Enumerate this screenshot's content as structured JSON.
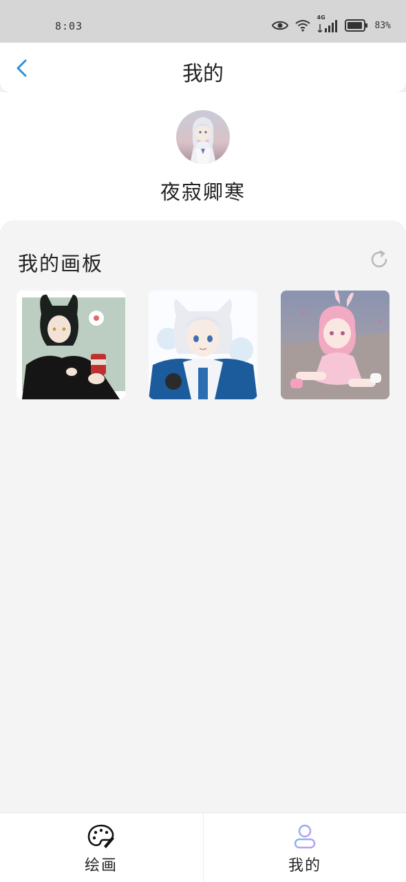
{
  "status_bar": {
    "time": "8:03",
    "network_label": "4G",
    "battery_text": "83%",
    "icons": [
      "eye-icon",
      "wifi-icon",
      "signal-icon",
      "battery-icon"
    ]
  },
  "header": {
    "title": "我的",
    "back_icon": "chevron-left-icon",
    "accent_color": "#2a8fd8"
  },
  "profile": {
    "username": "夜寂卿寒",
    "avatar": "anime-avatar"
  },
  "boards": {
    "title": "我的画板",
    "refresh_icon": "refresh-icon",
    "items": [
      {
        "image": "anime-cat-boy-black-hair-holding-can"
      },
      {
        "image": "anime-white-hair-cat-boy-blue-jacket"
      },
      {
        "image": "anime-pink-hair-bunny-girl"
      }
    ]
  },
  "tab_bar": {
    "tabs": [
      {
        "label": "绘画",
        "icon": "palette-icon"
      },
      {
        "label": "我的",
        "icon": "user-icon"
      }
    ]
  }
}
